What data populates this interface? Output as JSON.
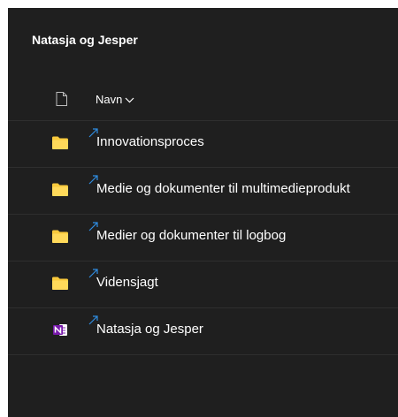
{
  "header": {
    "title": "Natasja og Jesper"
  },
  "columns": {
    "name_label": "Navn"
  },
  "items": [
    {
      "name": "Innovationsproces",
      "type": "folder",
      "icon": "folder-icon"
    },
    {
      "name": "Medie og dokumenter til multimedieprodukt",
      "type": "folder",
      "icon": "folder-icon"
    },
    {
      "name": "Medier og dokumenter til logbog",
      "type": "folder",
      "icon": "folder-icon"
    },
    {
      "name": "Vidensjagt",
      "type": "folder",
      "icon": "folder-icon"
    },
    {
      "name": "Natasja og Jesper",
      "type": "onenote",
      "icon": "onenote-icon"
    }
  ],
  "colors": {
    "background": "#1f1f1f",
    "text": "#ffffff",
    "folder": "#f8c93c",
    "onenote": "#7719aa",
    "sync_indicator": "#2f8ce0"
  }
}
